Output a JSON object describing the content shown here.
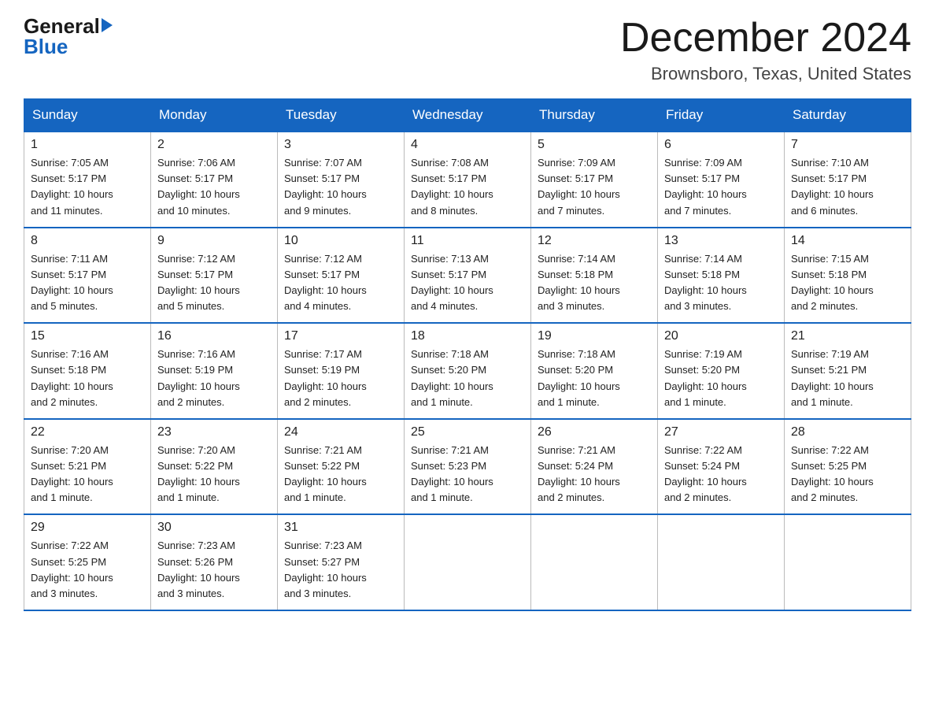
{
  "logo": {
    "general": "General",
    "blue": "Blue"
  },
  "header": {
    "month": "December 2024",
    "location": "Brownsboro, Texas, United States"
  },
  "days_of_week": [
    "Sunday",
    "Monday",
    "Tuesday",
    "Wednesday",
    "Thursday",
    "Friday",
    "Saturday"
  ],
  "weeks": [
    [
      {
        "day": "1",
        "info": "Sunrise: 7:05 AM\nSunset: 5:17 PM\nDaylight: 10 hours\nand 11 minutes."
      },
      {
        "day": "2",
        "info": "Sunrise: 7:06 AM\nSunset: 5:17 PM\nDaylight: 10 hours\nand 10 minutes."
      },
      {
        "day": "3",
        "info": "Sunrise: 7:07 AM\nSunset: 5:17 PM\nDaylight: 10 hours\nand 9 minutes."
      },
      {
        "day": "4",
        "info": "Sunrise: 7:08 AM\nSunset: 5:17 PM\nDaylight: 10 hours\nand 8 minutes."
      },
      {
        "day": "5",
        "info": "Sunrise: 7:09 AM\nSunset: 5:17 PM\nDaylight: 10 hours\nand 7 minutes."
      },
      {
        "day": "6",
        "info": "Sunrise: 7:09 AM\nSunset: 5:17 PM\nDaylight: 10 hours\nand 7 minutes."
      },
      {
        "day": "7",
        "info": "Sunrise: 7:10 AM\nSunset: 5:17 PM\nDaylight: 10 hours\nand 6 minutes."
      }
    ],
    [
      {
        "day": "8",
        "info": "Sunrise: 7:11 AM\nSunset: 5:17 PM\nDaylight: 10 hours\nand 5 minutes."
      },
      {
        "day": "9",
        "info": "Sunrise: 7:12 AM\nSunset: 5:17 PM\nDaylight: 10 hours\nand 5 minutes."
      },
      {
        "day": "10",
        "info": "Sunrise: 7:12 AM\nSunset: 5:17 PM\nDaylight: 10 hours\nand 4 minutes."
      },
      {
        "day": "11",
        "info": "Sunrise: 7:13 AM\nSunset: 5:17 PM\nDaylight: 10 hours\nand 4 minutes."
      },
      {
        "day": "12",
        "info": "Sunrise: 7:14 AM\nSunset: 5:18 PM\nDaylight: 10 hours\nand 3 minutes."
      },
      {
        "day": "13",
        "info": "Sunrise: 7:14 AM\nSunset: 5:18 PM\nDaylight: 10 hours\nand 3 minutes."
      },
      {
        "day": "14",
        "info": "Sunrise: 7:15 AM\nSunset: 5:18 PM\nDaylight: 10 hours\nand 2 minutes."
      }
    ],
    [
      {
        "day": "15",
        "info": "Sunrise: 7:16 AM\nSunset: 5:18 PM\nDaylight: 10 hours\nand 2 minutes."
      },
      {
        "day": "16",
        "info": "Sunrise: 7:16 AM\nSunset: 5:19 PM\nDaylight: 10 hours\nand 2 minutes."
      },
      {
        "day": "17",
        "info": "Sunrise: 7:17 AM\nSunset: 5:19 PM\nDaylight: 10 hours\nand 2 minutes."
      },
      {
        "day": "18",
        "info": "Sunrise: 7:18 AM\nSunset: 5:20 PM\nDaylight: 10 hours\nand 1 minute."
      },
      {
        "day": "19",
        "info": "Sunrise: 7:18 AM\nSunset: 5:20 PM\nDaylight: 10 hours\nand 1 minute."
      },
      {
        "day": "20",
        "info": "Sunrise: 7:19 AM\nSunset: 5:20 PM\nDaylight: 10 hours\nand 1 minute."
      },
      {
        "day": "21",
        "info": "Sunrise: 7:19 AM\nSunset: 5:21 PM\nDaylight: 10 hours\nand 1 minute."
      }
    ],
    [
      {
        "day": "22",
        "info": "Sunrise: 7:20 AM\nSunset: 5:21 PM\nDaylight: 10 hours\nand 1 minute."
      },
      {
        "day": "23",
        "info": "Sunrise: 7:20 AM\nSunset: 5:22 PM\nDaylight: 10 hours\nand 1 minute."
      },
      {
        "day": "24",
        "info": "Sunrise: 7:21 AM\nSunset: 5:22 PM\nDaylight: 10 hours\nand 1 minute."
      },
      {
        "day": "25",
        "info": "Sunrise: 7:21 AM\nSunset: 5:23 PM\nDaylight: 10 hours\nand 1 minute."
      },
      {
        "day": "26",
        "info": "Sunrise: 7:21 AM\nSunset: 5:24 PM\nDaylight: 10 hours\nand 2 minutes."
      },
      {
        "day": "27",
        "info": "Sunrise: 7:22 AM\nSunset: 5:24 PM\nDaylight: 10 hours\nand 2 minutes."
      },
      {
        "day": "28",
        "info": "Sunrise: 7:22 AM\nSunset: 5:25 PM\nDaylight: 10 hours\nand 2 minutes."
      }
    ],
    [
      {
        "day": "29",
        "info": "Sunrise: 7:22 AM\nSunset: 5:25 PM\nDaylight: 10 hours\nand 3 minutes."
      },
      {
        "day": "30",
        "info": "Sunrise: 7:23 AM\nSunset: 5:26 PM\nDaylight: 10 hours\nand 3 minutes."
      },
      {
        "day": "31",
        "info": "Sunrise: 7:23 AM\nSunset: 5:27 PM\nDaylight: 10 hours\nand 3 minutes."
      },
      {
        "day": "",
        "info": ""
      },
      {
        "day": "",
        "info": ""
      },
      {
        "day": "",
        "info": ""
      },
      {
        "day": "",
        "info": ""
      }
    ]
  ]
}
